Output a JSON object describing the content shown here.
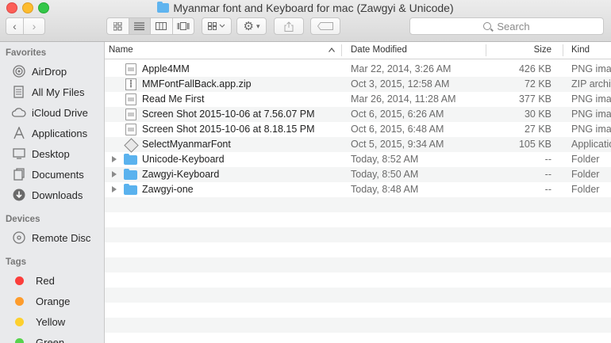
{
  "window": {
    "title": "Myanmar font and Keyboard for mac (Zawgyi & Unicode)"
  },
  "toolbar": {
    "back_icon": "chevron-left-icon",
    "forward_icon": "chevron-right-icon",
    "view_modes": [
      "icon-view",
      "list-view",
      "column-view",
      "cover-flow-view"
    ],
    "active_view": "list-view",
    "arrange_icon": "arrange-grid-icon",
    "action_icon": "gear-icon",
    "share_icon": "share-icon",
    "tag_icon": "tag-icon",
    "search_placeholder": "Search"
  },
  "sidebar": {
    "favorites_header": "Favorites",
    "favorites": [
      {
        "label": "AirDrop",
        "icon": "airdrop-icon"
      },
      {
        "label": "All My Files",
        "icon": "all-files-icon"
      },
      {
        "label": "iCloud Drive",
        "icon": "cloud-icon"
      },
      {
        "label": "Applications",
        "icon": "applications-icon"
      },
      {
        "label": "Desktop",
        "icon": "desktop-icon"
      },
      {
        "label": "Documents",
        "icon": "documents-icon"
      },
      {
        "label": "Downloads",
        "icon": "downloads-icon"
      }
    ],
    "devices_header": "Devices",
    "devices": [
      {
        "label": "Remote Disc",
        "icon": "disc-icon"
      }
    ],
    "tags_header": "Tags",
    "tags": [
      {
        "label": "Red",
        "color": "#fb3e3b"
      },
      {
        "label": "Orange",
        "color": "#fd9c2c"
      },
      {
        "label": "Yellow",
        "color": "#fdd02e"
      },
      {
        "label": "Green",
        "color": "#56d34c"
      }
    ]
  },
  "columns": {
    "name": "Name",
    "date": "Date Modified",
    "size": "Size",
    "kind": "Kind"
  },
  "files": [
    {
      "name": "Apple4MM",
      "date": "Mar 22, 2014, 3:26 AM",
      "size": "426 KB",
      "kind": "PNG image",
      "icon": "image-file-icon"
    },
    {
      "name": "MMFontFallBack.app.zip",
      "date": "Oct 3, 2015, 12:58 AM",
      "size": "72 KB",
      "kind": "ZIP archive",
      "icon": "zip-file-icon"
    },
    {
      "name": "Read Me First",
      "date": "Mar 26, 2014, 11:28 AM",
      "size": "377 KB",
      "kind": "PNG image",
      "icon": "image-file-icon"
    },
    {
      "name": "Screen Shot 2015-10-06 at 7.56.07 PM",
      "date": "Oct 6, 2015, 6:26 AM",
      "size": "30 KB",
      "kind": "PNG image",
      "icon": "image-file-icon"
    },
    {
      "name": "Screen Shot 2015-10-06 at 8.18.15 PM",
      "date": "Oct 6, 2015, 6:48 AM",
      "size": "27 KB",
      "kind": "PNG image",
      "icon": "image-file-icon"
    },
    {
      "name": "SelectMyanmarFont",
      "date": "Oct 5, 2015, 9:34 AM",
      "size": "105 KB",
      "kind": "Application",
      "icon": "app-icon"
    },
    {
      "name": "Unicode-Keyboard",
      "date": "Today, 8:52 AM",
      "size": "--",
      "kind": "Folder",
      "icon": "folder-icon"
    },
    {
      "name": "Zawgyi-Keyboard",
      "date": "Today, 8:50 AM",
      "size": "--",
      "kind": "Folder",
      "icon": "folder-icon"
    },
    {
      "name": "Zawgyi-one",
      "date": "Today, 8:48 AM",
      "size": "--",
      "kind": "Folder",
      "icon": "folder-icon"
    }
  ]
}
